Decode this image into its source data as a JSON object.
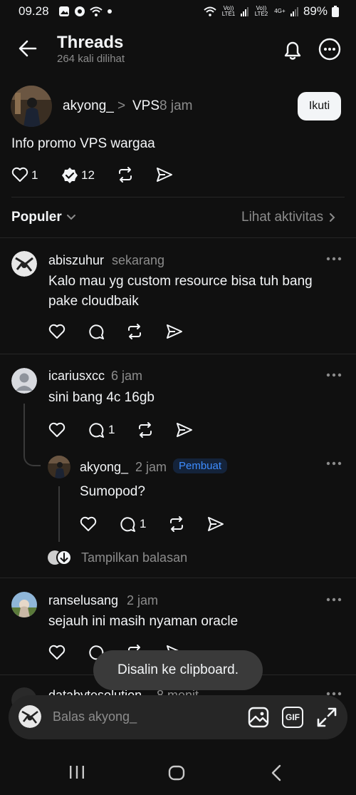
{
  "status_bar": {
    "time": "09.28",
    "battery": "89%",
    "sim1": "Vo)) LTE1",
    "sim2": "Vo)) LTE2",
    "network": "4G+"
  },
  "header": {
    "title": "Threads",
    "views": "264 kali dilihat"
  },
  "post": {
    "author": "akyong_",
    "separator": ">",
    "community": "VPS",
    "time": "8 jam",
    "follow_label": "Ikuti",
    "text": "Info promo VPS wargaa",
    "likes": "1",
    "replies": "12"
  },
  "sort": {
    "label": "Populer",
    "activity_label": "Lihat aktivitas"
  },
  "comments": [
    {
      "author": "abiszuhur",
      "time": "sekarang",
      "text": "Kalo mau yg custom resource bisa tuh bang pake cloudbaik"
    },
    {
      "author": "icariusxcc",
      "time": "6 jam",
      "text": "sini bang 4c 16gb",
      "replies": "1"
    },
    {
      "author": "akyong_",
      "time": "2 jam",
      "badge": "Pembuat",
      "text": "Sumopod?",
      "replies": "1"
    },
    {
      "author": "ranselusang",
      "time": "2 jam",
      "text": "sejauh ini masih nyaman oracle"
    },
    {
      "author": "databytesolution",
      "time": "8 menit"
    }
  ],
  "show_replies_label": "Tampilkan balasan",
  "toast": "Disalin ke clipboard.",
  "reply_bar": {
    "placeholder": "Balas akyong_",
    "gif_label": "GIF"
  },
  "colors": {
    "background": "#101010",
    "badge_text": "#3e8dff",
    "toast_bg": "#3a3a3a"
  }
}
